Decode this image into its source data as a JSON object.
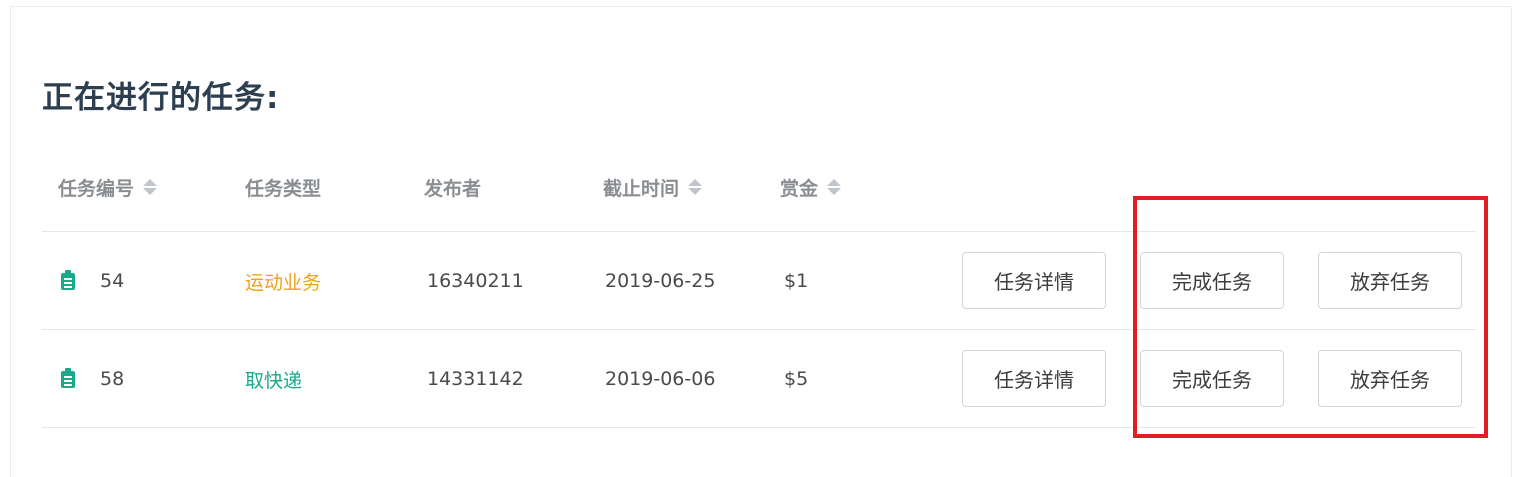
{
  "page": {
    "title": "正在进行的任务:"
  },
  "table": {
    "columns": [
      {
        "label": "任务编号",
        "sortable": true
      },
      {
        "label": "任务类型",
        "sortable": false
      },
      {
        "label": "发布者",
        "sortable": false
      },
      {
        "label": "截止时间",
        "sortable": true
      },
      {
        "label": "赏金",
        "sortable": true
      }
    ],
    "rows": [
      {
        "icon": "clipboard-icon",
        "id": "54",
        "type": "运动业务",
        "type_color": "#f0a020",
        "publisher": "16340211",
        "deadline": "2019-06-25",
        "reward": "$1",
        "actions": {
          "details": "任务详情",
          "complete": "完成任务",
          "abandon": "放弃任务"
        }
      },
      {
        "icon": "clipboard-icon",
        "id": "58",
        "type": "取快递",
        "type_color": "#1aaa8a",
        "publisher": "14331142",
        "deadline": "2019-06-06",
        "reward": "$5",
        "actions": {
          "details": "任务详情",
          "complete": "完成任务",
          "abandon": "放弃任务"
        }
      }
    ]
  },
  "colors": {
    "accent_green": "#1aaa8a",
    "accent_orange": "#f0a020",
    "highlight_red": "#e01e26"
  }
}
